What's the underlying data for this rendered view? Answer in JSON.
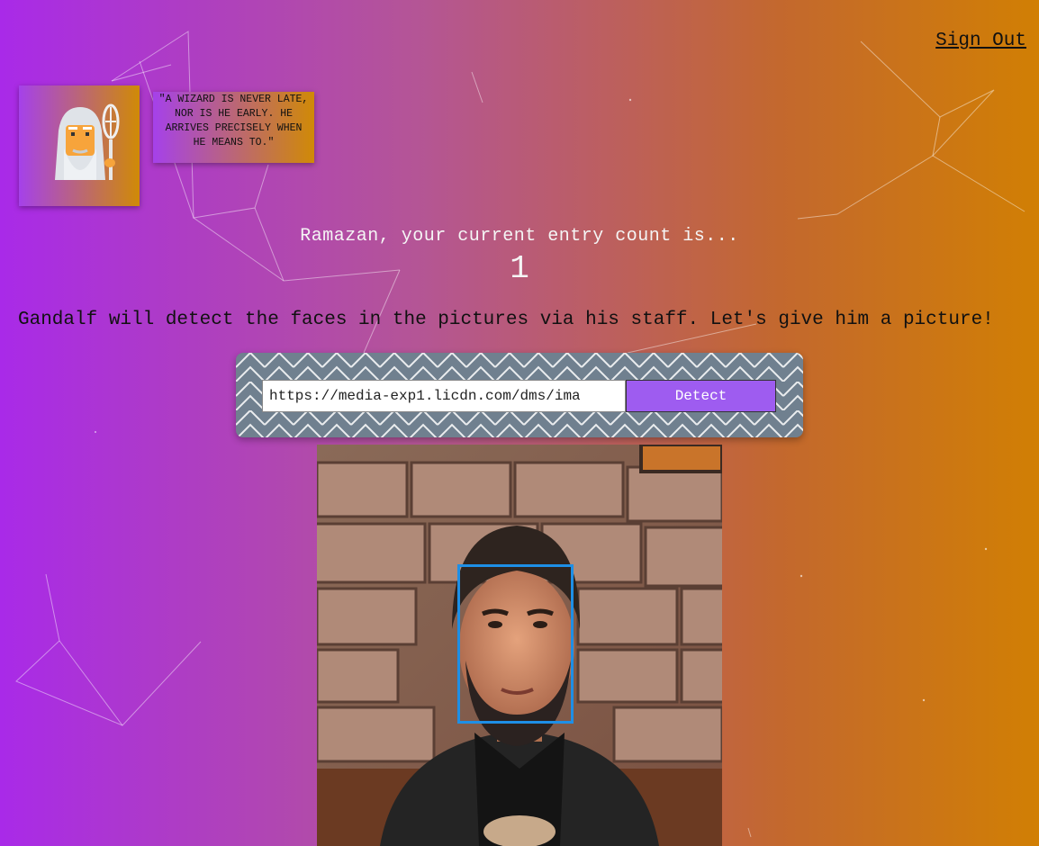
{
  "header": {
    "signout_label": "Sign Out"
  },
  "logo": {
    "icon": "wizard-icon"
  },
  "quote": {
    "text": "\"A WIZARD IS NEVER LATE, NOR IS HE EARLY. HE ARRIVES PRECISELY WHEN HE MEANS TO.\""
  },
  "rank": {
    "greeting": "Ramazan, your current entry count is...",
    "count": "1"
  },
  "instructions": {
    "text": "Gandalf will detect the faces in the pictures via his staff. Let's give him a picture!"
  },
  "form": {
    "url_value": "https://media-exp1.licdn.com/dms/ima",
    "button_label": "Detect"
  },
  "colors": {
    "gradient_start": "#a92ae8",
    "gradient_end": "#d17f04",
    "button": "#9e5cf0",
    "panel": "#70808f",
    "face_box": "#1e8fe6"
  }
}
